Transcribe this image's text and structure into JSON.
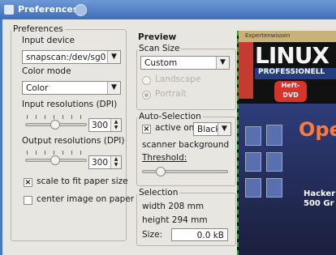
{
  "window": {
    "title": "Preferences"
  },
  "preferences": {
    "legend": "Preferences",
    "input_device_label": "Input device",
    "input_device_value": "snapscan:/dev/sg0",
    "color_mode_label": "Color mode",
    "color_mode_value": "Color",
    "input_res_label": "Input resolutions (DPI)",
    "input_res_value": "300",
    "output_res_label": "Output resolutions (DPI)",
    "output_res_value": "300",
    "scale_label": "scale to fit paper size",
    "scale_checked": true,
    "center_label": "center image on paper",
    "center_checked": false
  },
  "preview": {
    "title": "Preview",
    "scan_size": {
      "legend": "Scan Size",
      "value": "Custom",
      "opt1": "Landscape",
      "opt2": "Portrait"
    },
    "auto_selection": {
      "legend": "Auto-Selection",
      "active_label": "active on",
      "active_checked": true,
      "color_value": "Black",
      "scanner_bg": "scanner background",
      "threshold": "Threshold:"
    },
    "selection": {
      "legend": "Selection",
      "width": "width 208 mm",
      "height": "height 294 mm",
      "size_label": "Size:",
      "size_value": "0.0 kB"
    }
  },
  "cover": {
    "top_text": "Expertenwissen",
    "linux": "LINUX",
    "professional": "PROFESSIONELL",
    "dvd": "Heft-DVD",
    "open": "Open",
    "hacker": "Hacker",
    "gr": "500 Gr"
  }
}
